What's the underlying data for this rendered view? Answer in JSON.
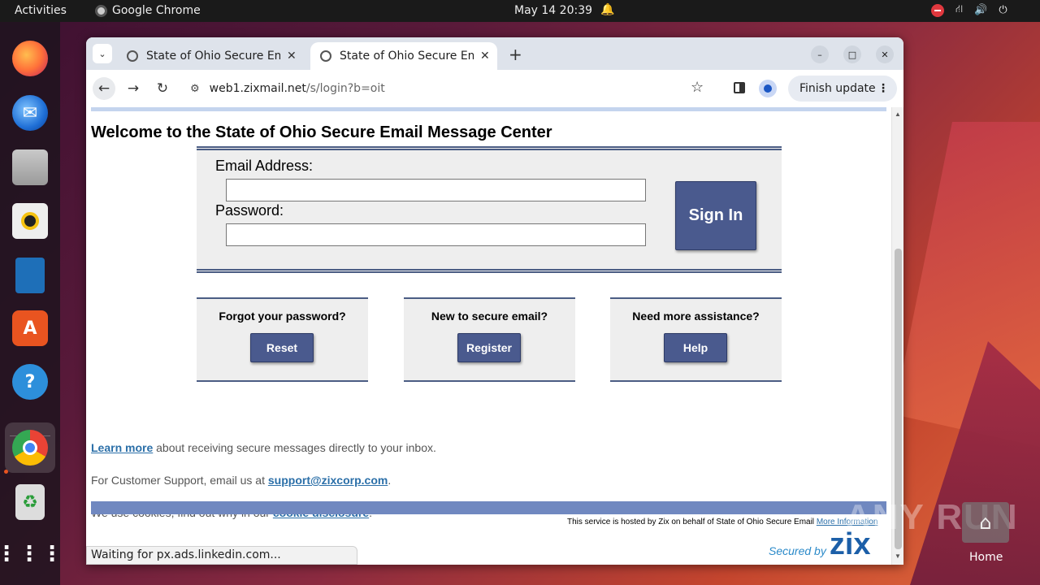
{
  "topbar": {
    "activities": "Activities",
    "app_name": "Google Chrome",
    "clock": "May 14  20:39"
  },
  "dock": {
    "items": [
      "Firefox",
      "Thunderbird",
      "Files",
      "Rhythmbox",
      "LibreOffice Writer",
      "App Center",
      "Help",
      "Google Chrome",
      "Trash",
      "Show Apps"
    ]
  },
  "browser": {
    "tabs": [
      {
        "title": "State of Ohio Secure Em",
        "active": false
      },
      {
        "title": "State of Ohio Secure Em",
        "active": true
      }
    ],
    "url_host": "web1.zixmail.net",
    "url_path": "/s/login?b=oit",
    "finish_update_label": "Finish update",
    "status_text": "Waiting for px.ads.linkedin.com..."
  },
  "page": {
    "welcome": "Welcome to the State of Ohio Secure Email Message Center",
    "email_label": "Email Address:",
    "password_label": "Password:",
    "email_value": "",
    "password_value": "",
    "signin_label": "Sign In",
    "panels": [
      {
        "question": "Forgot your password?",
        "button": "Reset"
      },
      {
        "question": "New to secure email?",
        "button": "Register"
      },
      {
        "question": "Need more assistance?",
        "button": "Help"
      }
    ],
    "learn_more_link": "Learn more",
    "learn_more_text": " about receiving secure messages directly to your inbox.",
    "support_text": "For Customer Support, email us at ",
    "support_link": "support@zixcorp.com",
    "support_end": ".",
    "cookie_text": "We use cookies, find out why in our ",
    "cookie_link": "cookie disclosure",
    "cookie_end": ".",
    "hosted_text": "This service is hosted by Zix on behalf of State of Ohio Secure Email ",
    "more_info_link": "More Information",
    "secured_by": "Secured by",
    "zix_logo": "zix"
  },
  "desktop": {
    "watermark": "ANY RUN",
    "home_label": "Home"
  },
  "colors": {
    "button_blue": "#4a5a8e",
    "rule_blue": "#4b5d84",
    "link_blue": "#2b6fa8",
    "footer_bar": "#7088c0"
  }
}
